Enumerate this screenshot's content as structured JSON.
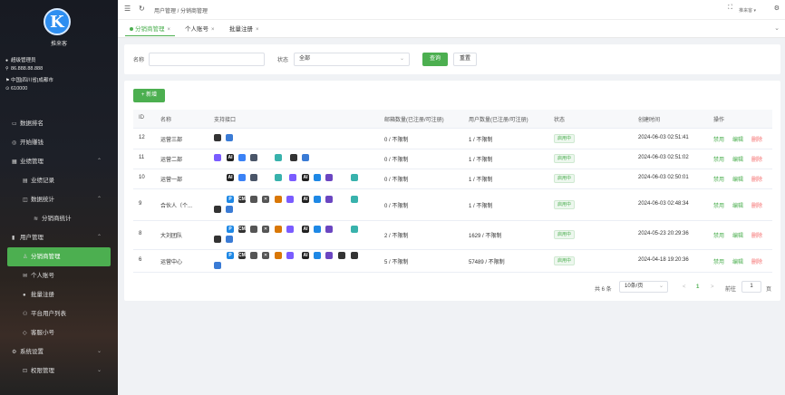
{
  "app": {
    "brand": "推来客"
  },
  "user": {
    "role": "超级管理员",
    "ip": "86.888.88.888",
    "location": "中国|四川省|成都市",
    "code": "610000"
  },
  "menu": [
    {
      "label": "数据排名",
      "icon": "monitor-icon",
      "level": 1
    },
    {
      "label": "开始赚钱",
      "icon": "coin-icon",
      "level": 1
    },
    {
      "label": "业绩管理",
      "icon": "calendar-icon",
      "level": 1,
      "expand": "^"
    },
    {
      "label": "业绩记录",
      "icon": "doc-icon",
      "level": 2
    },
    {
      "label": "数据统计",
      "icon": "chart-icon",
      "level": 2,
      "expand": "^"
    },
    {
      "label": "分销商统计",
      "icon": "stack-icon",
      "level": 3
    },
    {
      "label": "用户管理",
      "icon": "file-icon",
      "level": 1,
      "expand": "^"
    },
    {
      "label": "分销商管理",
      "icon": "user-icon",
      "level": 2,
      "active": true
    },
    {
      "label": "个人账号",
      "icon": "mail-icon",
      "level": 2
    },
    {
      "label": "批量注册",
      "icon": "person-icon",
      "level": 2
    },
    {
      "label": "平台用户列表",
      "icon": "people-icon",
      "level": 2
    },
    {
      "label": "客服小号",
      "icon": "tag-icon",
      "level": 2
    },
    {
      "label": "系统设置",
      "icon": "gear-icon",
      "level": 1,
      "expand": "v"
    },
    {
      "label": "权限管理",
      "icon": "lock-icon",
      "level": 2,
      "expand": "v"
    }
  ],
  "topbar": {
    "breadcrumb": "用户管理  /  分销商管理",
    "user_label": "推来客"
  },
  "tabs": [
    {
      "label": "分销商管理",
      "active": true
    },
    {
      "label": "个人账号"
    },
    {
      "label": "批量注册"
    }
  ],
  "filter": {
    "name_label": "名称",
    "name_value": "",
    "status_label": "状态",
    "status_value": "全部",
    "query_label": "查询",
    "reset_label": "重置"
  },
  "toolbar": {
    "add_label": "+ 新增"
  },
  "table": {
    "headers": [
      "ID",
      "名称",
      "支持接口",
      "邮箱数量(已注册/可注册)",
      "用户数量(已注册/可注册)",
      "状态",
      "创建时间",
      "操作"
    ],
    "rows": [
      {
        "id": "12",
        "name": "运营三部",
        "mail": "0 / 不限制",
        "users": "1 / 不限制",
        "status": "启用中",
        "created": "2024-06-03 02:51:41"
      },
      {
        "id": "11",
        "name": "运营二部",
        "mail": "0 / 不限制",
        "users": "1 / 不限制",
        "status": "启用中",
        "created": "2024-06-03 02:51:02"
      },
      {
        "id": "10",
        "name": "运营一部",
        "mail": "0 / 不限制",
        "users": "1 / 不限制",
        "status": "启用中",
        "created": "2024-06-03 02:50:01"
      },
      {
        "id": "9",
        "name": "合伙人（个...",
        "mail": "0 / 不限制",
        "users": "1 / 不限制",
        "status": "启用中",
        "created": "2024-06-03 02:48:34"
      },
      {
        "id": "8",
        "name": "大刘团队",
        "mail": "2 / 不限制",
        "users": "1629 / 不限制",
        "status": "启用中",
        "created": "2024-05-23 20:29:36"
      },
      {
        "id": "6",
        "name": "运营中心",
        "mail": "5 / 不限制",
        "users": "57489 / 不限制",
        "status": "启用中",
        "created": "2024-04-18 19:20:36"
      }
    ],
    "ops": {
      "disable": "禁用",
      "edit": "编辑",
      "delete": "删除"
    },
    "api_icon_glyph": {
      "ico-p": "P",
      "ico-cm": "CM",
      "ico-x": "✕",
      "ico-ai": "AI"
    }
  },
  "pager": {
    "total": "共 6 条",
    "size": "10条/页",
    "prev": "<",
    "page": "1",
    "next": ">",
    "goto": "前往",
    "goto_value": "1",
    "unit": "页"
  },
  "colors": {
    "accent": "#4caf50",
    "danger": "#f56c6c"
  }
}
